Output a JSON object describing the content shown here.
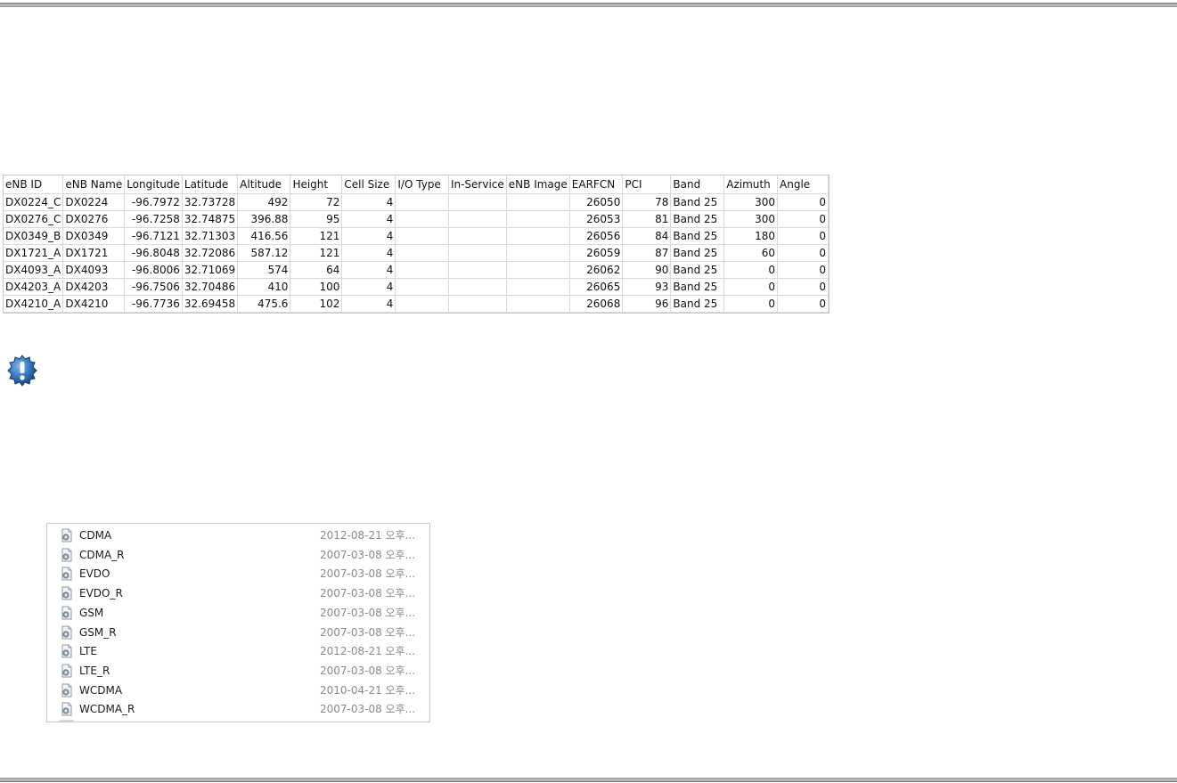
{
  "table": {
    "headers": [
      "eNB ID",
      "eNB Name",
      "Longitude",
      "Latitude",
      "Altitude",
      "Height",
      "Cell Size",
      "I/O Type",
      "In-Service",
      "eNB Image",
      "EARFCN",
      "PCI",
      "Band",
      "Azimuth",
      "Angle"
    ],
    "rows": [
      [
        "DX0224_C",
        "DX0224",
        "-96.7972",
        "32.73728",
        "492",
        "72",
        "4",
        "",
        "",
        "",
        "26050",
        "78",
        "Band 25",
        "300",
        "0"
      ],
      [
        "DX0276_C",
        "DX0276",
        "-96.7258",
        "32.74875",
        "396.88",
        "95",
        "4",
        "",
        "",
        "",
        "26053",
        "81",
        "Band 25",
        "300",
        "0"
      ],
      [
        "DX0349_B",
        "DX0349",
        "-96.7121",
        "32.71303",
        "416.56",
        "121",
        "4",
        "",
        "",
        "",
        "26056",
        "84",
        "Band 25",
        "180",
        "0"
      ],
      [
        "DX1721_A",
        "DX1721",
        "-96.8048",
        "32.72086",
        "587.12",
        "121",
        "4",
        "",
        "",
        "",
        "26059",
        "87",
        "Band 25",
        "60",
        "0"
      ],
      [
        "DX4093_A",
        "DX4093",
        "-96.8006",
        "32.71069",
        "574",
        "64",
        "4",
        "",
        "",
        "",
        "26062",
        "90",
        "Band 25",
        "0",
        "0"
      ],
      [
        "DX4203_A",
        "DX4203",
        "-96.7506",
        "32.70486",
        "410",
        "100",
        "4",
        "",
        "",
        "",
        "26065",
        "93",
        "Band 25",
        "0",
        "0"
      ],
      [
        "DX4210_A",
        "DX4210",
        "-96.7736",
        "32.69458",
        "475.6",
        "102",
        "4",
        "",
        "",
        "",
        "26068",
        "96",
        "Band 25",
        "0",
        "0"
      ]
    ],
    "numeric_columns": [
      2,
      3,
      4,
      5,
      6,
      10,
      11,
      13,
      14
    ]
  },
  "notice_icon": "exclamation-badge-icon",
  "files": [
    {
      "name": "CDMA",
      "date": "2012-08-21 오후..."
    },
    {
      "name": "CDMA_R",
      "date": "2007-03-08 오후..."
    },
    {
      "name": "EVDO",
      "date": "2007-03-08 오후..."
    },
    {
      "name": "EVDO_R",
      "date": "2007-03-08 오후..."
    },
    {
      "name": "GSM",
      "date": "2007-03-08 오후..."
    },
    {
      "name": "GSM_R",
      "date": "2007-03-08 오후..."
    },
    {
      "name": "LTE",
      "date": "2012-08-21 오후..."
    },
    {
      "name": "LTE_R",
      "date": "2007-03-08 오후..."
    },
    {
      "name": "WCDMA",
      "date": "2010-04-21 오후..."
    },
    {
      "name": "WCDMA_R",
      "date": "2007-03-08 오후..."
    }
  ],
  "file_icon": "settings-file-icon",
  "colors": {
    "notice_blue": "#1f5fa8",
    "rule_gray": "#b4b4b4"
  }
}
